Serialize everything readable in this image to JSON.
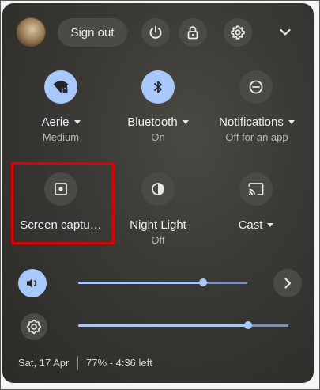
{
  "header": {
    "sign_out_label": "Sign out"
  },
  "tiles": [
    {
      "label": "Aerie",
      "sub": "Medium",
      "state": "on",
      "has_menu": true,
      "icon": "wifi-lock-icon"
    },
    {
      "label": "Bluetooth",
      "sub": "On",
      "state": "on",
      "has_menu": true,
      "icon": "bluetooth-icon"
    },
    {
      "label": "Notifications",
      "sub": "Off for an app",
      "state": "off",
      "has_menu": true,
      "icon": "notifications-off-icon"
    },
    {
      "label": "Screen captu…",
      "sub": "",
      "state": "off",
      "has_menu": false,
      "icon": "screen-capture-icon"
    },
    {
      "label": "Night Light",
      "sub": "Off",
      "state": "off",
      "has_menu": false,
      "icon": "night-light-icon"
    },
    {
      "label": "Cast",
      "sub": "",
      "state": "off",
      "has_menu": true,
      "icon": "cast-icon"
    }
  ],
  "sliders": {
    "volume_level": 0.74,
    "brightness_level": 0.81
  },
  "footer": {
    "date": "Sat, 17 Apr",
    "battery": "77% - 4:36 left"
  },
  "colors": {
    "accent": "#a8c7fa",
    "highlight_box": "#e00000"
  }
}
